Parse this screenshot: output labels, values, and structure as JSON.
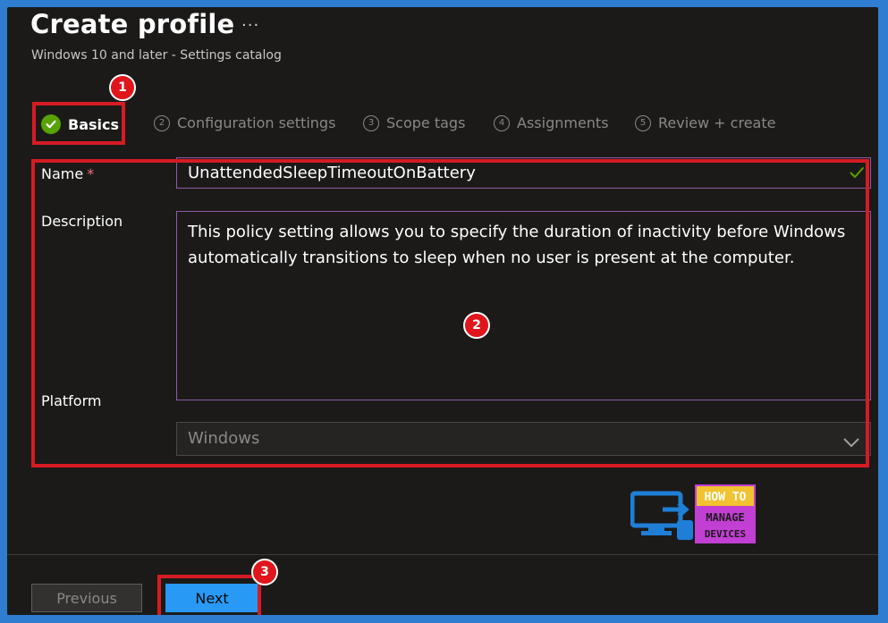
{
  "header": {
    "title": "Create profile",
    "more": "···",
    "subtitle": "Windows 10 and later - Settings catalog"
  },
  "steps": [
    {
      "number": "",
      "label": "Basics",
      "state": "complete"
    },
    {
      "number": "2",
      "label": "Configuration settings",
      "state": "pending"
    },
    {
      "number": "3",
      "label": "Scope tags",
      "state": "pending"
    },
    {
      "number": "4",
      "label": "Assignments",
      "state": "pending"
    },
    {
      "number": "5",
      "label": "Review + create",
      "state": "pending"
    }
  ],
  "form": {
    "name_label": "Name",
    "required_marker": "*",
    "name_value": "UnattendedSleepTimeoutOnBattery",
    "description_label": "Description",
    "description_value": "This policy setting allows you to specify the duration of inactivity before Windows automatically transitions to sleep when no user is present at the computer.",
    "platform_label": "Platform",
    "platform_value": "Windows"
  },
  "annotations": {
    "badge1": "1",
    "badge2": "2",
    "badge3": "3"
  },
  "logo": {
    "line1": "HOW TO",
    "line2": "MANAGE",
    "line3": "DEVICES"
  },
  "footer": {
    "previous_label": "Previous",
    "next_label": "Next"
  },
  "colors": {
    "accent": "#2899f5",
    "success": "#57a300",
    "annotation_red": "#d61b23",
    "input_border": "#8e5aa8"
  }
}
